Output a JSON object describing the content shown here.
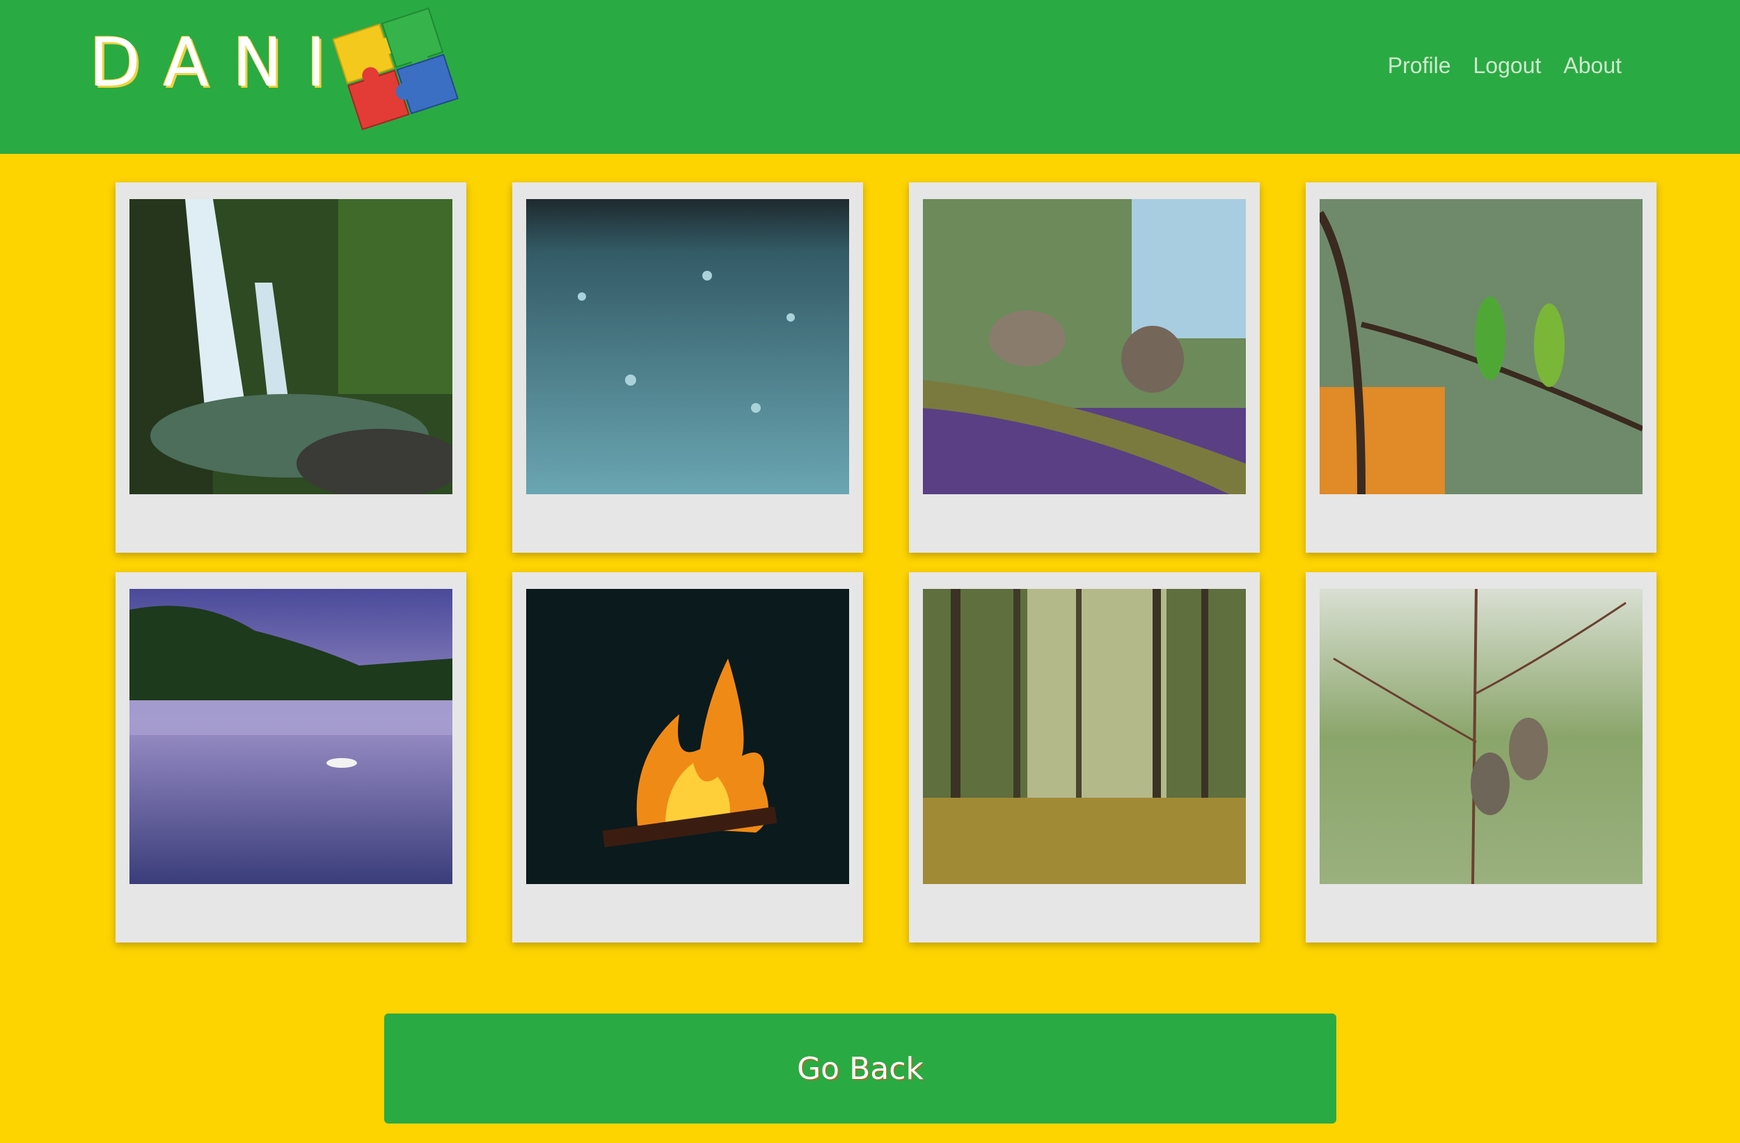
{
  "header": {
    "logo_text": "DANI",
    "nav": [
      {
        "label": "Profile"
      },
      {
        "label": "Logout"
      },
      {
        "label": "About"
      }
    ]
  },
  "gallery": {
    "items": [
      {
        "icon": "waterfall-photo"
      },
      {
        "icon": "rain-water-photo"
      },
      {
        "icon": "sparrows-on-branch-photo"
      },
      {
        "icon": "parrots-on-branch-photo"
      },
      {
        "icon": "swan-lake-photo"
      },
      {
        "icon": "campfire-photo"
      },
      {
        "icon": "forest-photo"
      },
      {
        "icon": "birds-on-twigs-photo"
      }
    ]
  },
  "footer": {
    "back_label": "Go Back"
  },
  "colors": {
    "header_bg": "#2aaa43",
    "page_bg": "#fdd300",
    "card_bg": "#e6e6e6",
    "button_bg": "#2aaa43"
  }
}
